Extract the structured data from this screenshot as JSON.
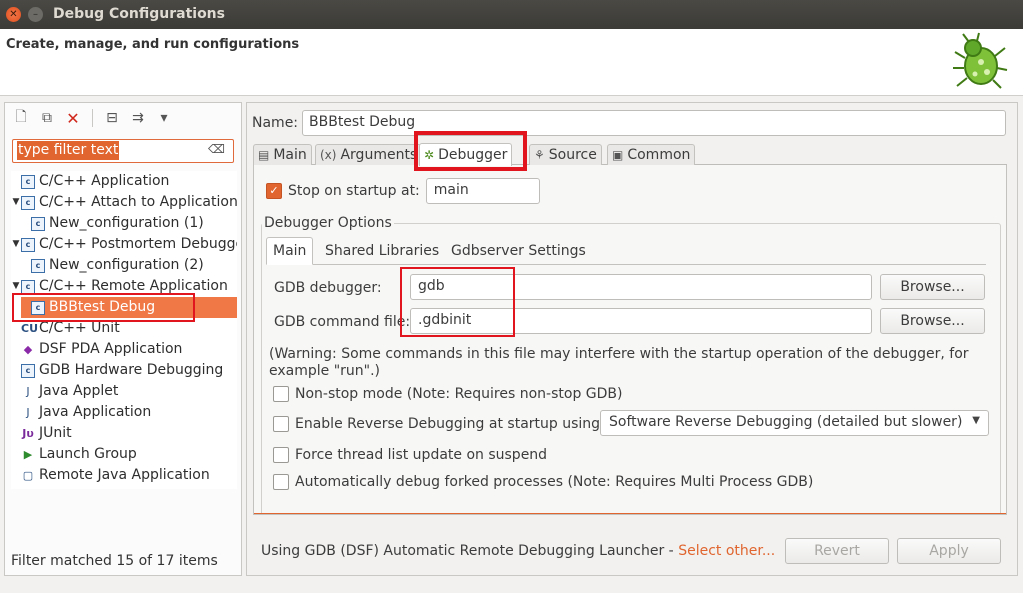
{
  "window": {
    "title": "Debug Configurations"
  },
  "header": {
    "title": "Create, manage, and run configurations",
    "icon": "bug-icon"
  },
  "left": {
    "toolbar": [
      "new-config-icon",
      "duplicate-icon",
      "delete-icon",
      "collapse-all-icon",
      "filter-icon",
      "dropdown-icon"
    ],
    "filter_placeholder": "type filter text",
    "tree": [
      {
        "label": "C/C++ Application",
        "level": 0,
        "expandable": false,
        "icon": "c-app-icon"
      },
      {
        "label": "C/C++ Attach to Application",
        "level": 0,
        "expandable": true,
        "icon": "c-app-icon"
      },
      {
        "label": "New_configuration (1)",
        "level": 1,
        "expandable": false,
        "icon": "c-app-icon"
      },
      {
        "label": "C/C++ Postmortem Debugger",
        "level": 0,
        "expandable": true,
        "icon": "c-app-icon"
      },
      {
        "label": "New_configuration (2)",
        "level": 1,
        "expandable": false,
        "icon": "c-app-icon"
      },
      {
        "label": "C/C++ Remote Application",
        "level": 0,
        "expandable": true,
        "icon": "c-app-icon"
      },
      {
        "label": "BBBtest Debug",
        "level": 1,
        "expandable": false,
        "icon": "c-app-icon",
        "selected": true
      },
      {
        "label": "C/C++ Unit",
        "level": 0,
        "expandable": false,
        "icon": "cunit-icon"
      },
      {
        "label": "DSF PDA Application",
        "level": 0,
        "expandable": false,
        "icon": "pda-icon"
      },
      {
        "label": "GDB Hardware Debugging",
        "level": 0,
        "expandable": false,
        "icon": "c-app-icon"
      },
      {
        "label": "Java Applet",
        "level": 0,
        "expandable": false,
        "icon": "java-applet-icon"
      },
      {
        "label": "Java Application",
        "level": 0,
        "expandable": false,
        "icon": "java-app-icon"
      },
      {
        "label": "JUnit",
        "level": 0,
        "expandable": false,
        "icon": "junit-icon"
      },
      {
        "label": "Launch Group",
        "level": 0,
        "expandable": false,
        "icon": "launch-group-icon"
      },
      {
        "label": "Remote Java Application",
        "level": 0,
        "expandable": false,
        "icon": "remote-java-icon"
      }
    ],
    "status": "Filter matched 15 of 17 items"
  },
  "right": {
    "name_label": "Name:",
    "name_value": "BBBtest Debug",
    "tabs": [
      {
        "label": "Main",
        "icon": "main-tab-icon"
      },
      {
        "label": "Arguments",
        "icon": "arguments-icon"
      },
      {
        "label": "Debugger",
        "icon": "debugger-bug-icon",
        "active": true
      },
      {
        "label": "Source",
        "icon": "source-icon"
      },
      {
        "label": "Common",
        "icon": "common-icon"
      }
    ],
    "stop_on_startup": {
      "label": "Stop on startup at:",
      "checked": true,
      "value": "main"
    },
    "debugger_options_title": "Debugger Options",
    "subtabs": [
      "Main",
      "Shared Libraries",
      "Gdbserver Settings"
    ],
    "gdb_debugger": {
      "label": "GDB debugger:",
      "value": "gdb",
      "browse": "Browse..."
    },
    "gdb_command_file": {
      "label": "GDB command file:",
      "value": ".gdbinit",
      "browse": "Browse..."
    },
    "warning_line1": "(Warning: Some commands in this file may interfere with the startup operation of the debugger, for",
    "warning_line2": "example \"run\".)",
    "nonstop": {
      "label": "Non-stop mode (Note: Requires non-stop GDB)",
      "checked": false
    },
    "reverse": {
      "label": "Enable Reverse Debugging at startup using:",
      "checked": false,
      "select": "Software Reverse Debugging (detailed but slower)"
    },
    "force_thread": {
      "label": "Force thread list update on suspend",
      "checked": false
    },
    "auto_debug": {
      "label": "Automatically debug forked processes (Note: Requires Multi Process GDB)",
      "checked": false
    },
    "launcher_text": "Using GDB (DSF) Automatic Remote Debugging Launcher - ",
    "select_other": "Select other...",
    "revert": "Revert",
    "apply": "Apply"
  },
  "colors": {
    "accent": "#e0652e",
    "highlight_box": "#e0151e"
  }
}
